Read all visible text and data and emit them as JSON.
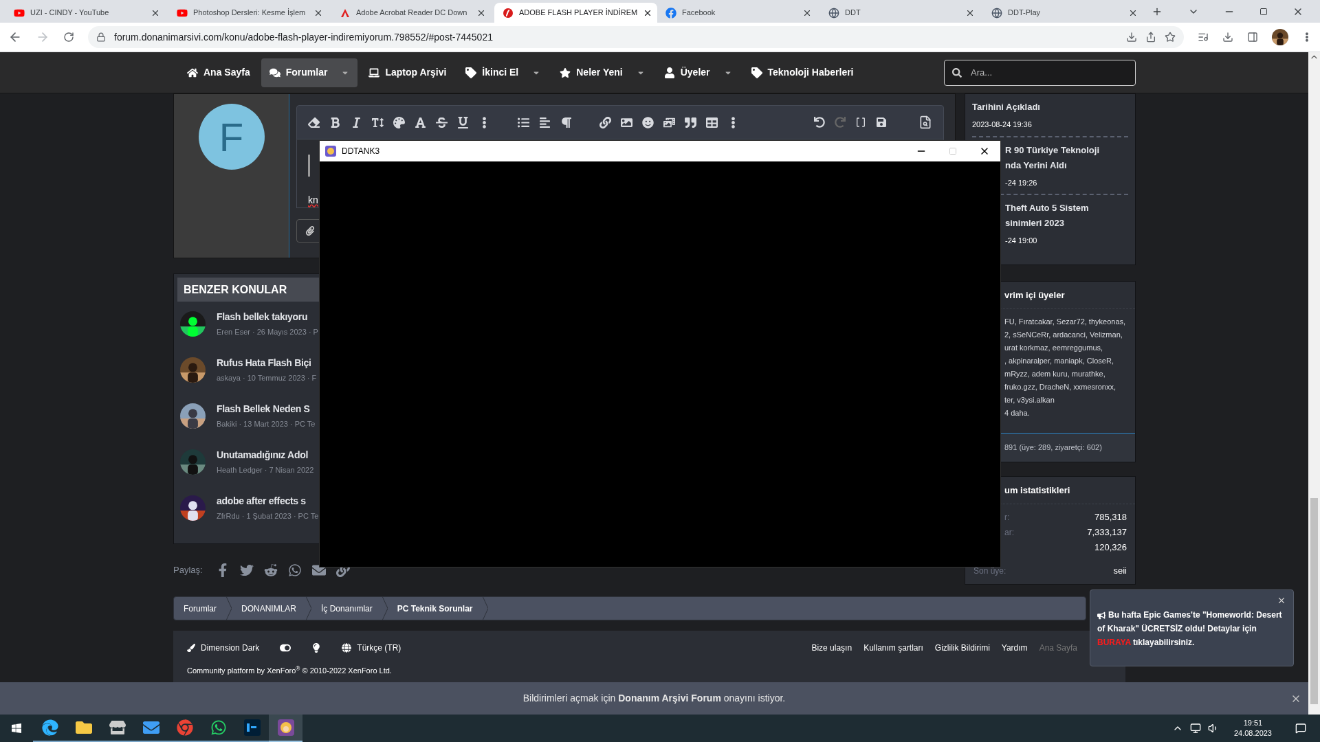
{
  "browser": {
    "tabs": [
      {
        "title": "UZI - CINDY - YouTube",
        "selected": false
      },
      {
        "title": "Photoshop Dersleri: Kesme İşlem",
        "selected": false
      },
      {
        "title": "Adobe Acrobat Reader DC Down",
        "selected": false
      },
      {
        "title": "ADOBE FLASH PLAYER İNDİREM",
        "selected": true
      },
      {
        "title": "Facebook",
        "selected": false
      },
      {
        "title": "DDT",
        "selected": false
      },
      {
        "title": "DDT-Play",
        "selected": false
      }
    ],
    "url": "forum.donanimarsivi.com/konu/adobe-flash-player-indiremiyorum.798552/#post-7445021"
  },
  "nav": {
    "items": [
      {
        "label": "Ana Sayfa",
        "selected": false,
        "dropdown": false
      },
      {
        "label": "Forumlar",
        "selected": true,
        "dropdown": true
      },
      {
        "label": "Laptop Arşivi",
        "selected": false,
        "dropdown": false
      },
      {
        "label": "İkinci El",
        "selected": false,
        "dropdown": true
      },
      {
        "label": "Neler Yeni",
        "selected": false,
        "dropdown": true
      },
      {
        "label": "Üyeler",
        "selected": false,
        "dropdown": true
      },
      {
        "label": "Teknoloji Haberleri",
        "selected": false,
        "dropdown": false
      }
    ],
    "search": {
      "placeholder": "Ara..."
    }
  },
  "editor": {
    "avatar_letter": "F",
    "text": "kn"
  },
  "similar": {
    "title": "BENZER KONULAR",
    "threads": [
      {
        "title": "Flash bellek takıyoru",
        "meta": "Eren Eser · 26 Mayıs 2023 · P"
      },
      {
        "title": "Rufus Hata Flash Biçi",
        "meta": "askaya · 10 Temmuz 2023 · F"
      },
      {
        "title": "Flash Bellek Neden S",
        "meta": "Bakiki · 13 Mart 2023 · PC Te"
      },
      {
        "title": "Unutamadığınız Adol",
        "meta": "Heath Ledger · 7 Nisan 2022"
      },
      {
        "title": "adobe after effects s",
        "meta": "ZfrRdu · 1 Şubat 2023 · PC Te"
      }
    ]
  },
  "share": {
    "label": "Paylaş:"
  },
  "breadcrumb": [
    {
      "label": "Forumlar",
      "current": false
    },
    {
      "label": "DONANIMLAR",
      "current": false
    },
    {
      "label": "İç Donanımlar",
      "current": false
    },
    {
      "label": "PC Teknik Sorunlar",
      "current": true
    }
  ],
  "footer": {
    "style": "Dimension Dark",
    "language": "Türkçe (TR)",
    "links": [
      "Bize ulaşın",
      "Kullanım şartları",
      "Gizlilik Bildirimi",
      "Yardım",
      "Ana Sayfa"
    ],
    "copyright_before": "Community platform by XenForo",
    "copyright_after": " © 2010-2022 XenForo Ltd.",
    "reg": "®"
  },
  "sidebar": {
    "news": [
      {
        "lines": [
          "Tarihini Açıkladı"
        ],
        "date": "2023-08-24 19:36"
      },
      {
        "lines": [
          "R 90 Türkiye Teknoloji",
          "nda Yerini Aldı"
        ],
        "date": "-24 19:26"
      },
      {
        "lines": [
          "Theft Auto 5 Sistem",
          "sinimleri 2023"
        ],
        "date": "-24 19:00"
      }
    ],
    "online": {
      "title": "vrim içi üyeler",
      "lines": [
        "FU, Fıratcakar, Sezar72, thykeonas,",
        "2, sSeNCeRr, ardacanci, Velizman,",
        "urat korkmaz, eemreggumus,",
        ", akpinaralper, maniapk, CloseR,",
        "mRyzz, adem kuru, murathke,",
        "fruko.gzz, DracheN, xxmesronxx,",
        "ter, v3ysi.alkan",
        "4 daha."
      ],
      "total": "891 (üye: 289, ziyaretçi: 602)"
    },
    "stats": {
      "title": "um istatistikleri",
      "rows": [
        {
          "label": "r:",
          "value": "785,318"
        },
        {
          "label": "ar:",
          "value": "7,333,137"
        },
        {
          "value": "120,326"
        },
        {
          "label": "Son üye:",
          "value": "seii"
        }
      ]
    }
  },
  "game_window": {
    "title": "DDTANK3"
  },
  "toast": {
    "before": "Bu hafta Epic Games'te \"Homeworld: Desert of Kharak\" ÜCRETSİZ oldu! Detaylar için ",
    "link": "BURAYA",
    "after": " tıklayabilirsiniz."
  },
  "notification": {
    "text": "Bildirimleri açmak için **Donanım Arşivi Forum** onayını istiyor."
  },
  "taskbar": {
    "time": "19:51",
    "date": "24.08.2023"
  }
}
